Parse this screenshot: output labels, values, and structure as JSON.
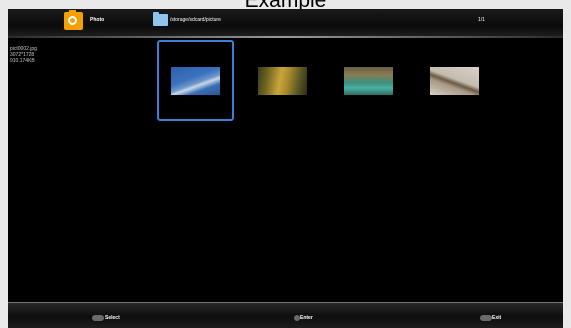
{
  "caption": "Example",
  "header": {
    "app_title": "Photo",
    "path": "/storage/sdcard/picture",
    "page": "1/1"
  },
  "info": {
    "filename": "pict0002.jpg",
    "resolution": "3072*1728",
    "size": "910.174KB"
  },
  "thumbnails": [
    {
      "icon": "sea-photo",
      "selected": true
    },
    {
      "icon": "forest-path-photo",
      "selected": false
    },
    {
      "icon": "lake-photo",
      "selected": false
    },
    {
      "icon": "bird-on-branch-photo",
      "selected": false
    }
  ],
  "footer": {
    "select_label": "Select",
    "enter_label": "Enter",
    "exit_label": "Exit"
  },
  "colors": {
    "accent": "#3b7fd6",
    "photo_icon": "#f5a000",
    "folder_icon": "#8fc4ee"
  }
}
